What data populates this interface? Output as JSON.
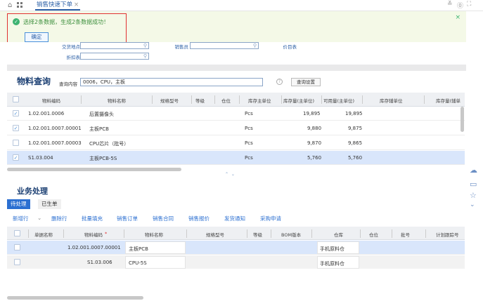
{
  "topbar": {
    "tab_label": "销售快速下单",
    "tab_close": "×"
  },
  "notice": {
    "message": "选择2条数据，生成2条数据成功！",
    "ok_label": "确定",
    "close": "×"
  },
  "form": {
    "field_a": "交货地点",
    "field_b": "折扣表",
    "field_c": "销售员",
    "field_d": "价目表"
  },
  "material_query": {
    "title": "物料查询",
    "query_label": "查询内容",
    "query_value": "0006，CPU，主板",
    "settings_button": "查询设置",
    "help": "?",
    "columns": [
      "物料编码",
      "物料名称",
      "规格型号",
      "等级",
      "仓位",
      "库存主单位",
      "库存量(主单位)",
      "可用量(主单位)",
      "库存辅单位",
      "库存量(辅单"
    ],
    "rows": [
      {
        "checked": true,
        "code": "1.02.001.0006",
        "name": "后置摄像头",
        "spec": "",
        "unit": "Pcs",
        "stock": "19,895",
        "avail": "19,895",
        "selected": false
      },
      {
        "checked": true,
        "code": "1.02.001.0007.00001",
        "name": "主板PCB",
        "spec": "",
        "unit": "Pcs",
        "stock": "9,880",
        "avail": "9,875",
        "selected": false
      },
      {
        "checked": false,
        "code": "1.02.001.0007.00003",
        "name": "CPU芯片（批号）",
        "spec": "",
        "unit": "Pcs",
        "stock": "9,870",
        "avail": "9,865",
        "selected": false
      },
      {
        "checked": true,
        "code": "S1.03.004",
        "name": "主板PCB-5S",
        "spec": "",
        "unit": "Pcs",
        "stock": "5,760",
        "avail": "5,760",
        "selected": true
      }
    ]
  },
  "business": {
    "title": "业务处理",
    "tabs": [
      "待处理",
      "已生单"
    ],
    "toolbar": [
      "新增行",
      "删除行",
      "批量填充",
      "销售订单",
      "销售合同",
      "销售报价",
      "发货通知",
      "采购申请"
    ],
    "columns": [
      "单据名称",
      "物料编码",
      "物料名称",
      "规格型号",
      "等级",
      "BOM版本",
      "仓库",
      "仓位",
      "批号",
      "计划跟踪号"
    ],
    "rows": [
      {
        "code": "1.02.001.0007.00001",
        "name": "主板PCB",
        "warehouse": "手机原料仓",
        "selected": true
      },
      {
        "code": "S1.03.006",
        "name": "CPU-5S",
        "warehouse": "手机原料仓",
        "selected": false
      }
    ]
  }
}
